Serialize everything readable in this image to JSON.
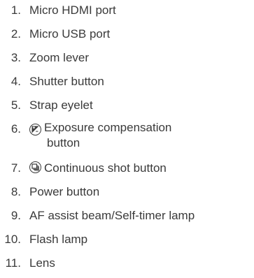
{
  "parts": [
    {
      "number": "1.",
      "label": "Micro HDMI port"
    },
    {
      "number": "2.",
      "label": "Micro USB port"
    },
    {
      "number": "3.",
      "label": "Zoom lever"
    },
    {
      "number": "4.",
      "label": "Shutter button"
    },
    {
      "number": "5.",
      "label": "Strap eyelet"
    },
    {
      "number": "6.",
      "label_line1": "Exposure compensation",
      "label_line2": "button",
      "icon": "exposure-compensation-icon"
    },
    {
      "number": "7.",
      "label": "Continuous shot button",
      "icon": "continuous-shot-icon"
    },
    {
      "number": "8.",
      "label": "Power button"
    },
    {
      "number": "9.",
      "label": "AF assist beam/Self-timer lamp"
    },
    {
      "number": "10.",
      "label": "Flash lamp"
    },
    {
      "number": "11.",
      "label": "Lens"
    }
  ],
  "colors": {
    "text": "#3a3a3a",
    "background": "#ffffff"
  }
}
